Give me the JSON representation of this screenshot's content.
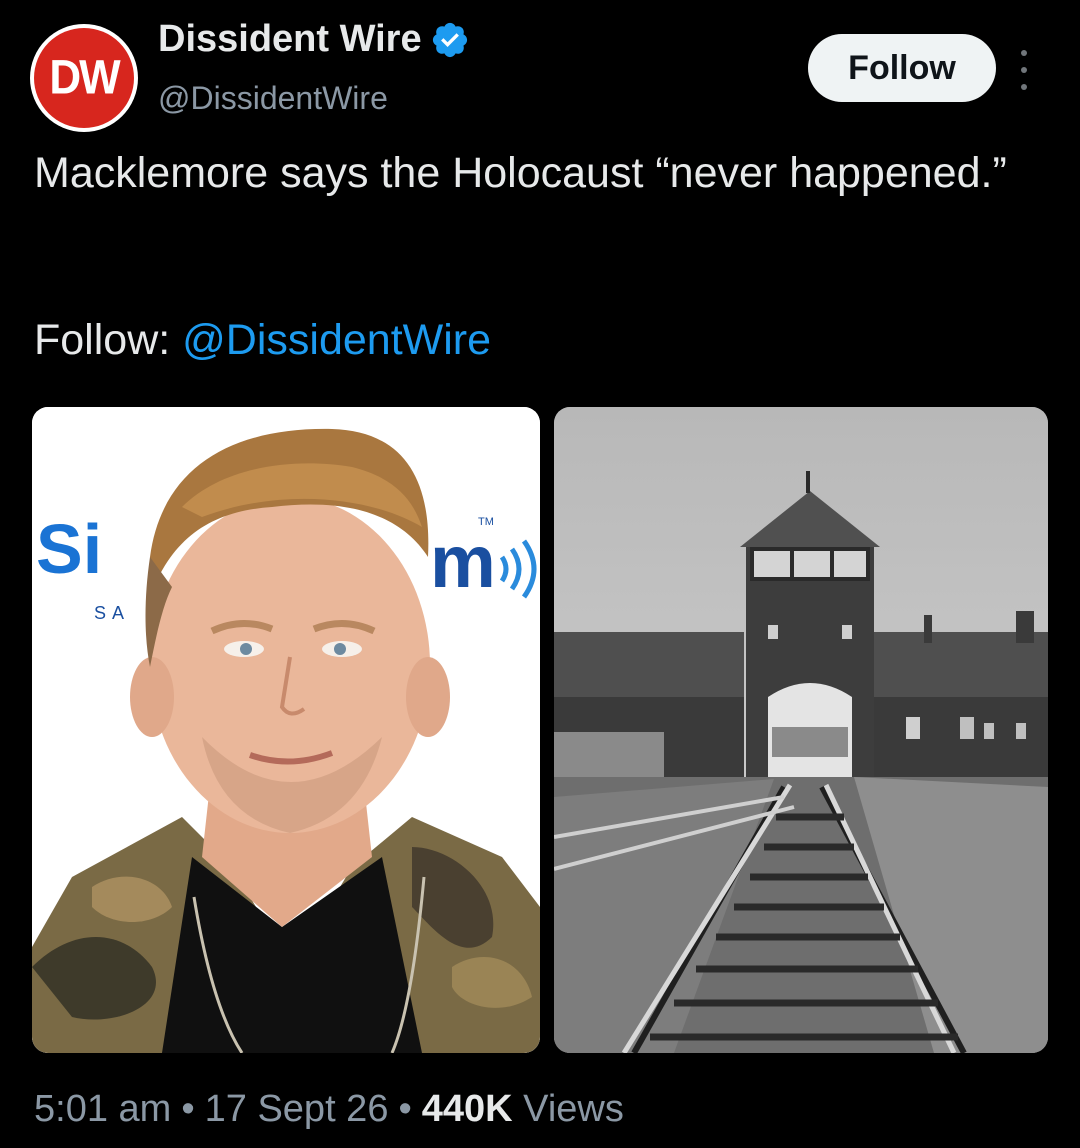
{
  "post": {
    "author": {
      "avatar_text": "DW",
      "display_name": "Dissident Wire",
      "handle": "@DissidentWire",
      "verified": true
    },
    "follow_button": "Follow",
    "text": "Macklemore says the Holocaust “never happened.”",
    "follow_prefix": "Follow: ",
    "follow_mention": "@DissidentWire",
    "media": {
      "left_logo_text": "Si",
      "left_logo_text_2": "m",
      "left_logo_sub": "SA",
      "left_logo_tm": "TM"
    },
    "time": "5:01 am",
    "date": "17 Sept 26",
    "views_count": "440K",
    "views_label": "Views",
    "separator": "•"
  },
  "colors": {
    "background": "#000000",
    "text": "#e7e9ea",
    "muted": "#8b98a5",
    "link": "#1d9bf0",
    "verified": "#1d9bf0",
    "avatar_bg": "#d7261e"
  },
  "icons": {
    "verified": "verified-badge-icon",
    "more": "more-vertical-icon"
  }
}
